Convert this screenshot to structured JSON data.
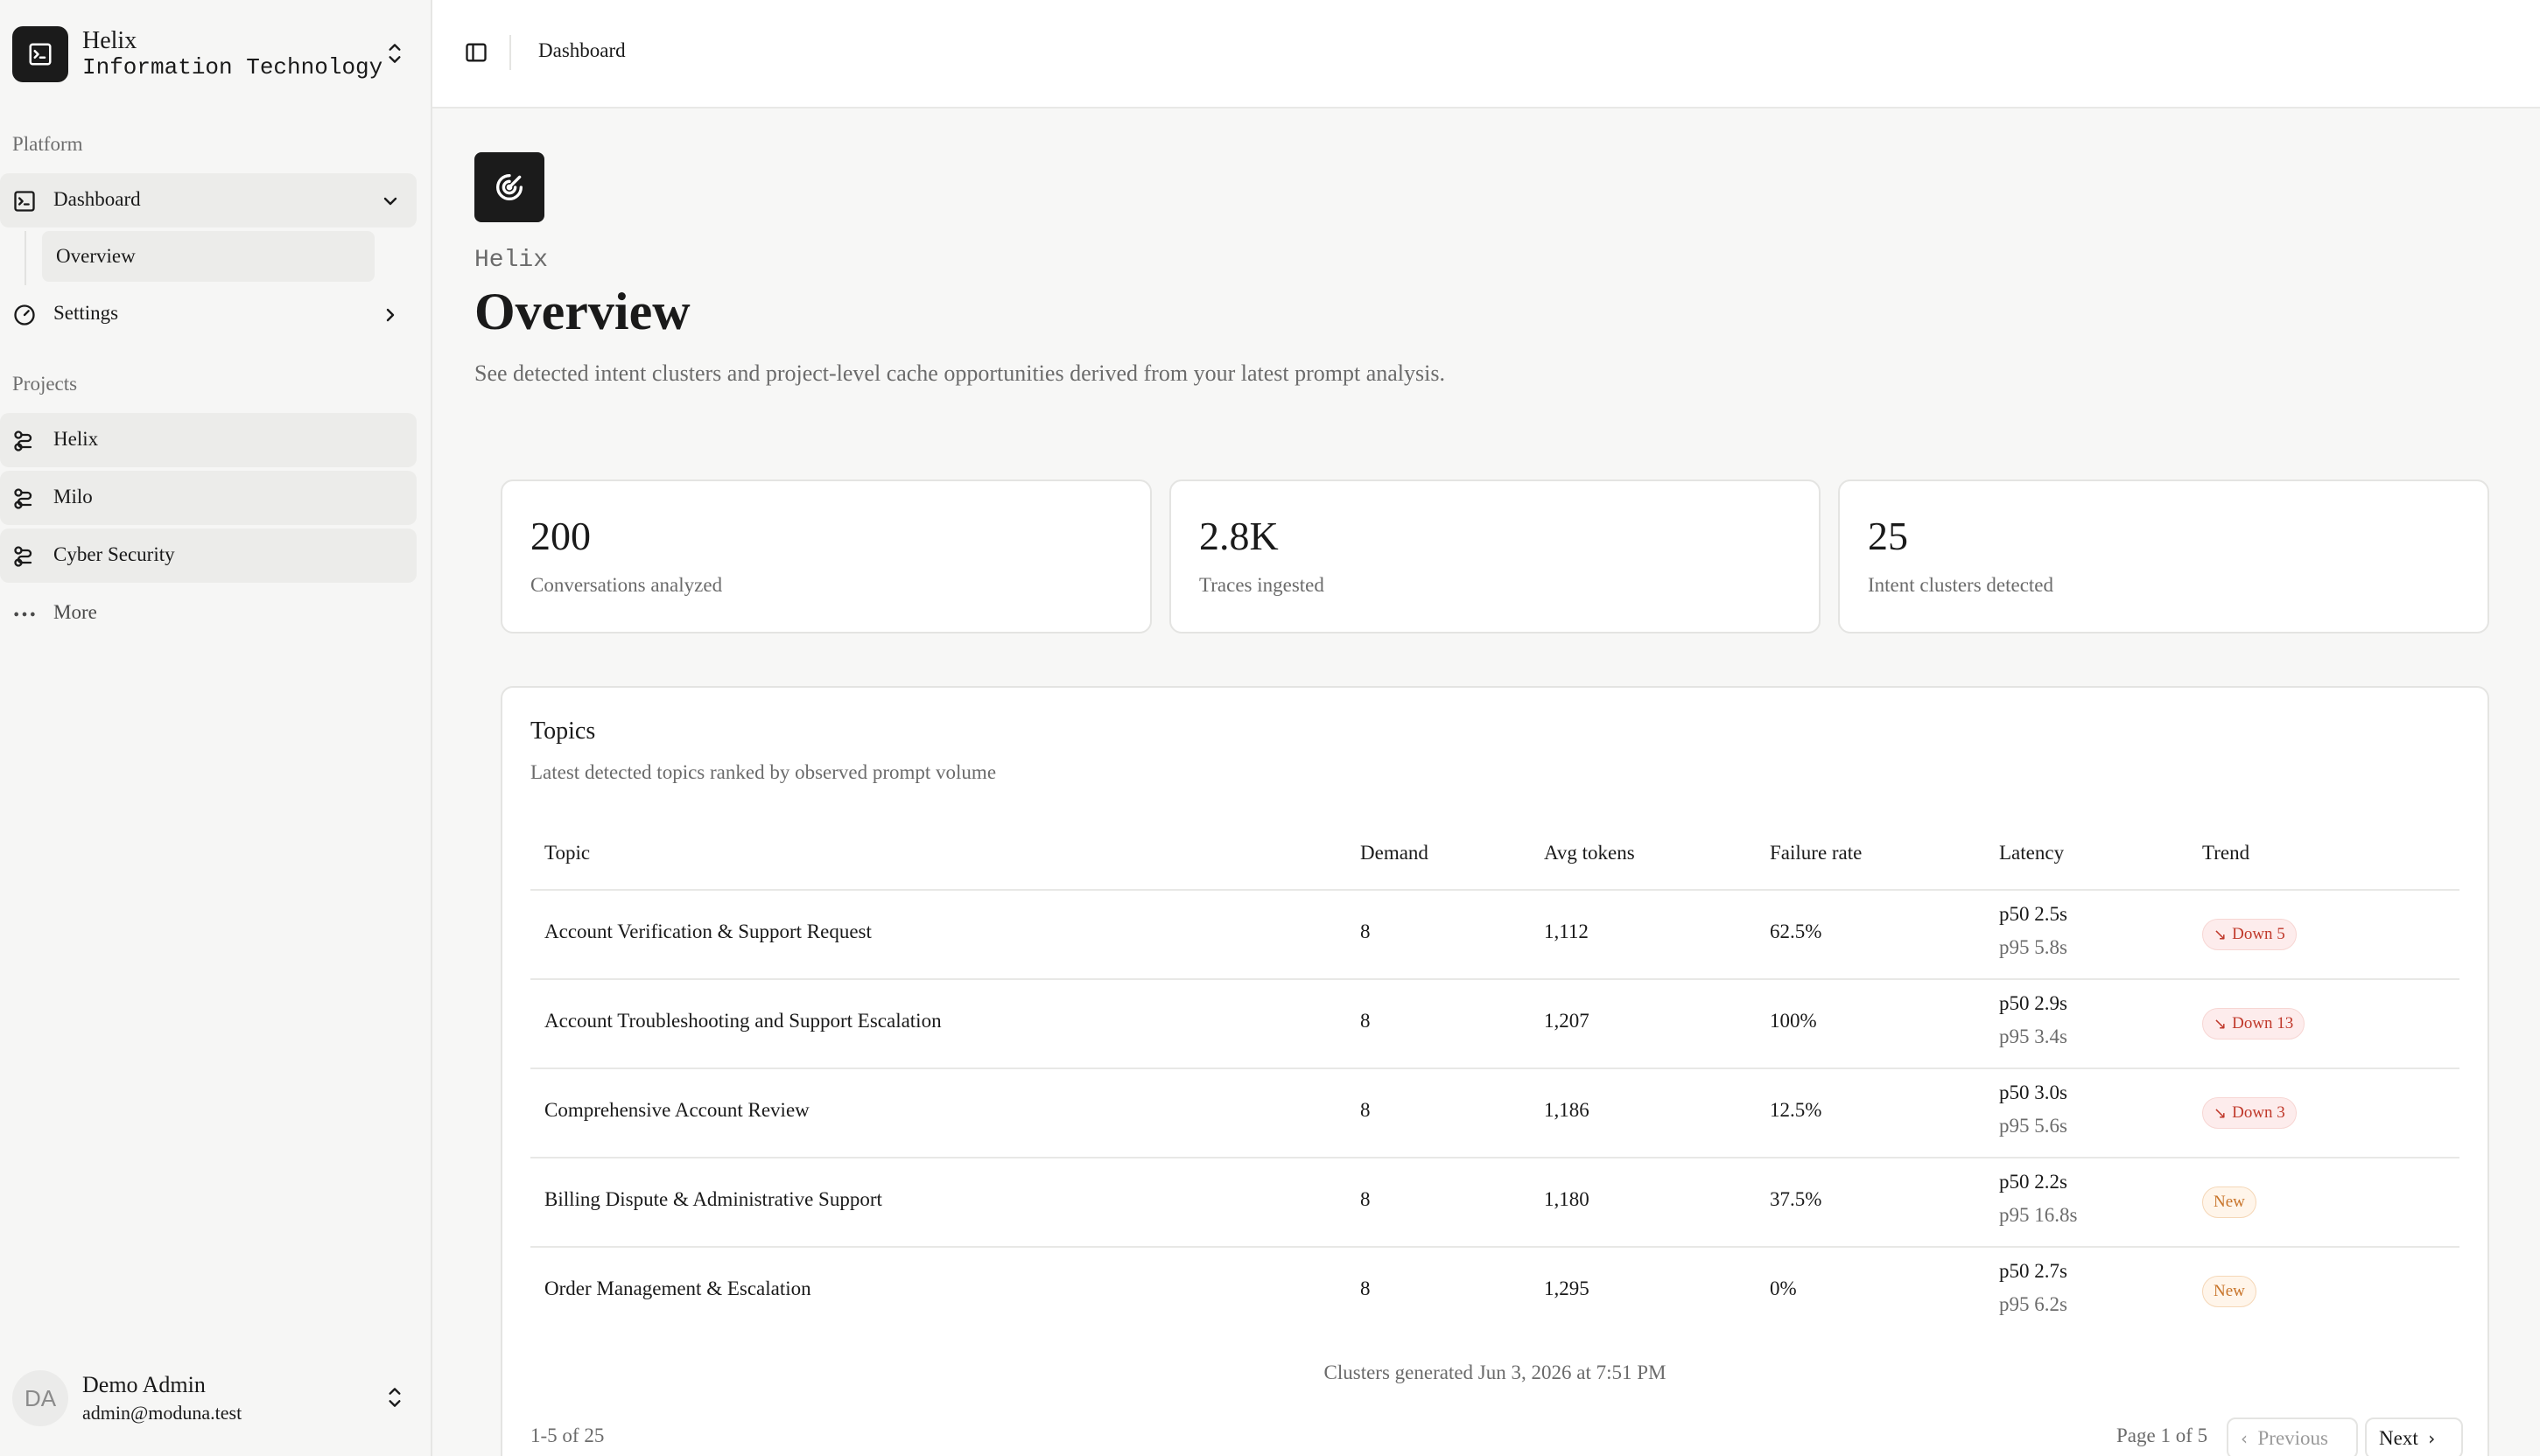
{
  "org": {
    "name": "Helix",
    "subtitle": "Information Technology"
  },
  "sidebar": {
    "platform_label": "Platform",
    "projects_label": "Projects",
    "dashboard": {
      "label": "Dashboard",
      "sub": "Overview"
    },
    "settings": {
      "label": "Settings"
    },
    "projects": [
      "Helix",
      "Milo",
      "Cyber Security"
    ],
    "more": "More",
    "user": {
      "initials": "DA",
      "name": "Demo Admin",
      "email": "admin@moduna.test"
    }
  },
  "header": {
    "breadcrumb": "Dashboard"
  },
  "page": {
    "eyebrow": "Helix",
    "title": "Overview",
    "description": "See detected intent clusters and project-level cache opportunities derived from your latest prompt analysis."
  },
  "stats": [
    {
      "value": "200",
      "label": "Conversations analyzed"
    },
    {
      "value": "2.8K",
      "label": "Traces ingested"
    },
    {
      "value": "25",
      "label": "Intent clusters detected"
    }
  ],
  "topics": {
    "title": "Topics",
    "subtitle": "Latest detected topics ranked by observed prompt volume",
    "columns": [
      "Topic",
      "Demand",
      "Avg tokens",
      "Failure rate",
      "Latency",
      "Trend"
    ],
    "rows": [
      {
        "topic": "Account Verification & Support Request",
        "demand": "8",
        "avg_tokens": "1,112",
        "failure": "62.5%",
        "p50": "p50 2.5s",
        "p95": "p95 5.8s",
        "trend": "Down 5",
        "trend_type": "down"
      },
      {
        "topic": "Account Troubleshooting and Support Escalation",
        "demand": "8",
        "avg_tokens": "1,207",
        "failure": "100%",
        "p50": "p50 2.9s",
        "p95": "p95 3.4s",
        "trend": "Down 13",
        "trend_type": "down"
      },
      {
        "topic": "Comprehensive Account Review",
        "demand": "8",
        "avg_tokens": "1,186",
        "failure": "12.5%",
        "p50": "p50 3.0s",
        "p95": "p95 5.6s",
        "trend": "Down 3",
        "trend_type": "down"
      },
      {
        "topic": "Billing Dispute & Administrative Support",
        "demand": "8",
        "avg_tokens": "1,180",
        "failure": "37.5%",
        "p50": "p50 2.2s",
        "p95": "p95 16.8s",
        "trend": "New",
        "trend_type": "new"
      },
      {
        "topic": "Order Management & Escalation",
        "demand": "8",
        "avg_tokens": "1,295",
        "failure": "0%",
        "p50": "p50 2.7s",
        "p95": "p95 6.2s",
        "trend": "New",
        "trend_type": "new"
      }
    ],
    "generated": "Clusters generated Jun 3, 2026 at 7:51 PM",
    "range": "1-5 of 25",
    "page_indicator": "Page 1 of 5",
    "prev_label": "Previous",
    "next_label": "Next"
  },
  "colors": {
    "trend_down": "#c0392b",
    "trend_down_bg": "#fdecec",
    "trend_new": "#c8742a",
    "trend_new_bg": "#fff5ea",
    "logo_bg": "#1b1b1b"
  }
}
